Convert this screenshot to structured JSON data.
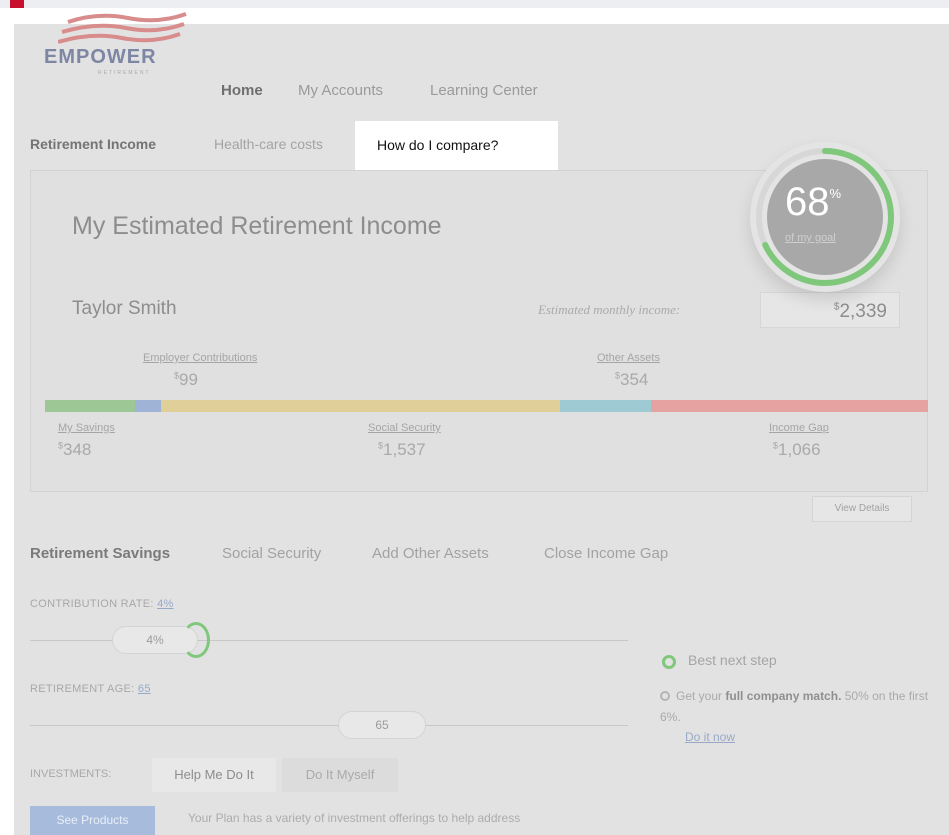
{
  "brand": {
    "name": "EMPOWER",
    "subline": "RETIREMENT",
    "accent": "#c8102e",
    "flag_color": "#d98c8c"
  },
  "nav": {
    "items": [
      "Home",
      "My Accounts",
      "Learning Center"
    ]
  },
  "subtabs": {
    "items": [
      "Retirement Income",
      "Health-care costs",
      "How do I compare?"
    ]
  },
  "income": {
    "title": "My Estimated Retirement Income",
    "name": "Taylor Smith",
    "estimated_label": "Estimated monthly income:",
    "estimated_value": "2,339",
    "gauge": {
      "percent": "68",
      "percent_sign": "%",
      "goal_label": "of my goal",
      "fill_fraction": 0.68,
      "color": "#7fc77a"
    }
  },
  "segments": {
    "top": [
      {
        "label": "Employer Contributions",
        "value": "99"
      },
      {
        "label": "Other Assets",
        "value": "354"
      }
    ],
    "bottom": [
      {
        "label": "My Savings",
        "value": "348"
      },
      {
        "label": "Social Security",
        "value": "1,537"
      },
      {
        "label": "Income Gap",
        "value": "1,066"
      }
    ],
    "bar": [
      {
        "name": "my-savings",
        "value": 348,
        "color": "#9dc896"
      },
      {
        "name": "employer-contributions",
        "value": 99,
        "color": "#9fb3d6"
      },
      {
        "name": "social-security",
        "value": 1537,
        "color": "#e1cf9a"
      },
      {
        "name": "other-assets",
        "value": 354,
        "color": "#9ecbd3"
      },
      {
        "name": "income-gap",
        "value": 1066,
        "color": "#e6a1a1"
      }
    ]
  },
  "view_details_label": "View Details",
  "tabs2": {
    "items": [
      "Retirement Savings",
      "Social Security",
      "Add Other Assets",
      "Close Income Gap"
    ]
  },
  "contribution": {
    "label": "CONTRIBUTION RATE:",
    "link_value": "4%",
    "handle_value": "4%"
  },
  "retirement_age": {
    "label": "RETIREMENT AGE:",
    "link_value": "65",
    "handle_value": "65"
  },
  "next_step": {
    "title": "Best next step",
    "text_before": "Get your",
    "text_bold": "full company match.",
    "text_after": "50% on the first 6%.",
    "link": "Do it now"
  },
  "investments": {
    "label": "INVESTMENTS:",
    "tab_help": "Help Me Do It",
    "tab_myself": "Do It Myself"
  },
  "see_products_label": "See Products",
  "plan_text": "Your Plan has a variety of investment offerings to help address"
}
